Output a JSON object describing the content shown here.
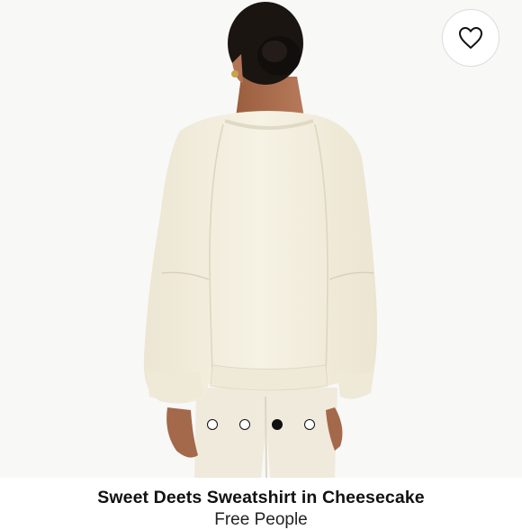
{
  "product": {
    "title": "Sweet Deets Sweatshirt in Cheesecake",
    "brand": "Free People"
  },
  "gallery": {
    "image": "model wearing cream sweatshirt, back view",
    "dots": [
      {
        "active": false
      },
      {
        "active": false
      },
      {
        "active": true
      },
      {
        "active": false
      }
    ]
  },
  "wishlist": {
    "icon": "heart-icon"
  },
  "colors": {
    "garment": "#f3efe0",
    "background": "#f8f8f7",
    "text": "#111111"
  }
}
